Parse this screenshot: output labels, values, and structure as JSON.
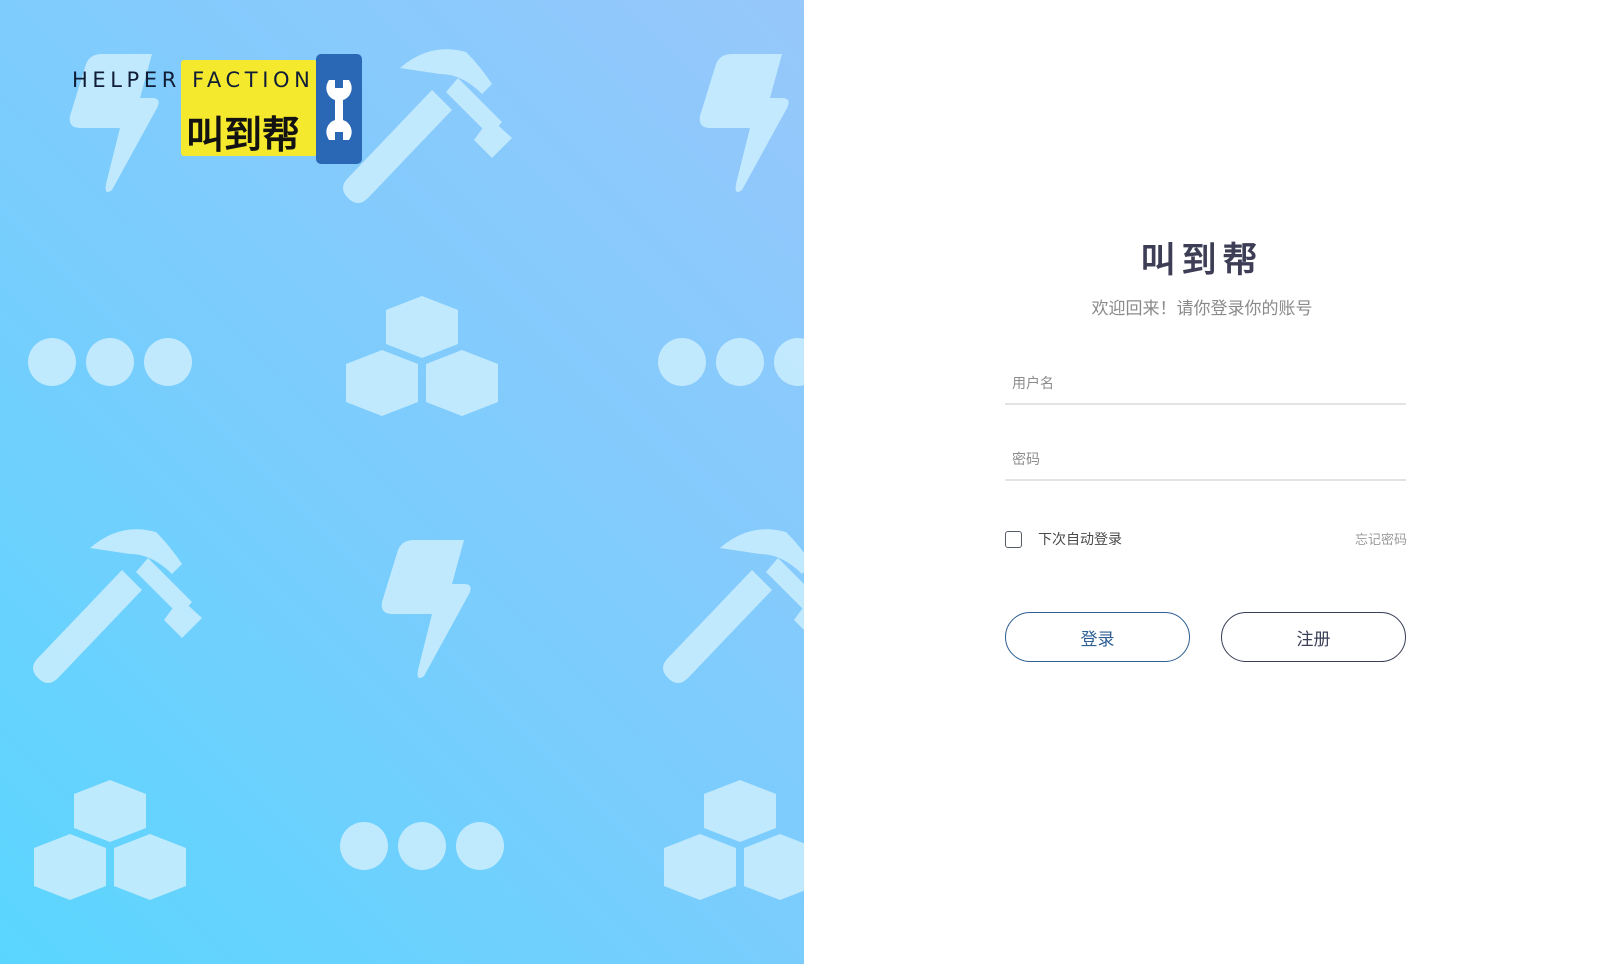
{
  "colors": {
    "hero_gradient_start": "#5ad6fe",
    "hero_gradient_end": "#97c7fb",
    "pattern_icon": "#c7ecfd",
    "logo_yellow": "#f5e92e",
    "logo_blue": "#2a67b4",
    "title": "#3d3d55",
    "login_border": "#2e5f95",
    "register_border": "#3a3f58"
  },
  "hero": {
    "logo": {
      "text_en": "HELPER FACTION",
      "text_cn": "叫到帮",
      "icon": "wrench-icon"
    },
    "pattern_icons": [
      "lightning-icon",
      "hammer-icon",
      "more-dots-icon",
      "cubes-icon"
    ]
  },
  "login": {
    "title": "叫到帮",
    "subtitle": "欢迎回来！请你登录你的账号",
    "username": {
      "placeholder": "用户名",
      "value": ""
    },
    "password": {
      "placeholder": "密码",
      "value": ""
    },
    "remember_label": "下次自动登录",
    "remember_checked": false,
    "forgot_label": "忘记密码",
    "login_button": "登录",
    "register_button": "注册"
  }
}
